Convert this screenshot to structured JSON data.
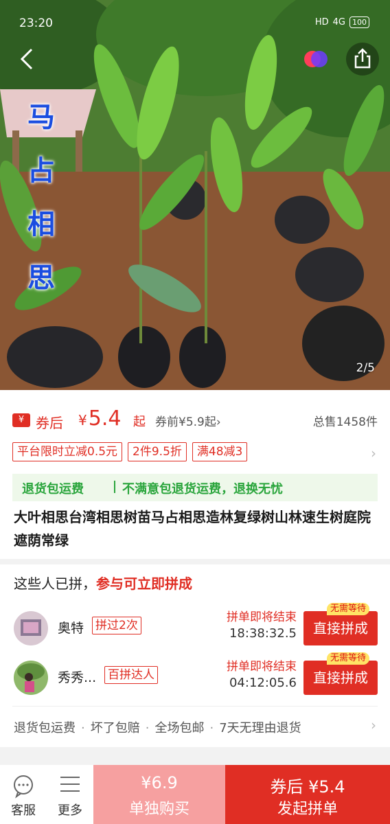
{
  "status_bar": {
    "time": "23:20",
    "signal": "4G",
    "hd": "HD",
    "battery": "100"
  },
  "gallery": {
    "title_chars": [
      "马",
      "占",
      "相",
      "思"
    ],
    "pager": "2/5"
  },
  "price": {
    "coupon_icon": "¥",
    "after_label": "券后",
    "currency": "¥",
    "value": "5.4",
    "qi": "起",
    "before": "券前¥5.9起",
    "before_arrow": "›",
    "sold": "总售1458件"
  },
  "promos": [
    "平台限时立减0.5元",
    "2件9.5折",
    "满48减3"
  ],
  "promo_arrow": "›",
  "guarantee": {
    "left": "退货包运费",
    "right": "不满意包退货运费，退换无忧"
  },
  "product": {
    "title": "大叶相思台湾相思树苗马占相思造林复绿树山林速生树庭院遮荫常绿"
  },
  "group": {
    "heading": "这些人已拼，",
    "heading_accent": "参与可立即拼成",
    "rows": [
      {
        "name": "奥特",
        "badge": "拼过2次",
        "ending": "拼单即将结束",
        "countdown": "18:38:32.5",
        "button": "直接拼成",
        "tag": "无需等待"
      },
      {
        "name": "秀秀...",
        "badge": "百拼达人",
        "ending": "拼单即将结束",
        "countdown": "04:12:05.6",
        "button": "直接拼成",
        "tag": "无需等待"
      }
    ],
    "services": [
      "退货包运费",
      "坏了包赔",
      "全场包邮",
      "7天无理由退货"
    ],
    "services_sep": "·",
    "services_arrow": "›"
  },
  "bottom_bar": {
    "service_label": "客服",
    "more_label": "更多",
    "alone_price": "¥6.9",
    "alone_label": "单独购买",
    "group_price": "券后 ¥5.4",
    "group_label": "发起拼单"
  },
  "colors": {
    "accent": "#e02e24",
    "green": "#2aa53c",
    "title_blue": "#1a4de0"
  }
}
